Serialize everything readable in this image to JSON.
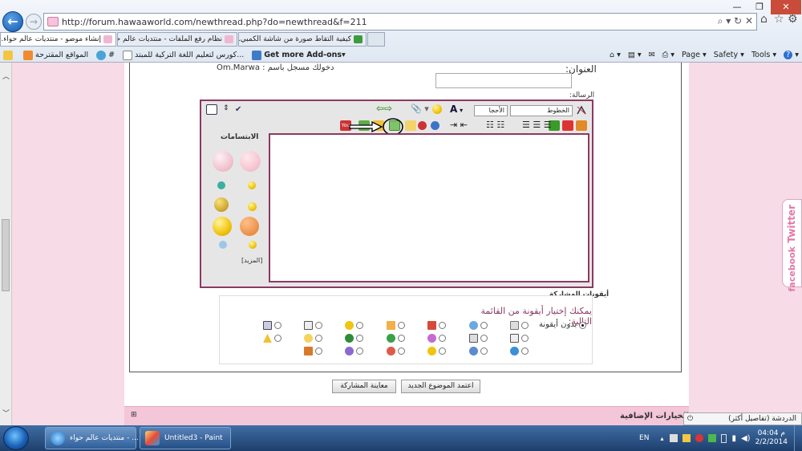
{
  "browser": {
    "url": "http://forum.hawaaworld.com/newthread.php?do=newthread&f=211",
    "tabs": [
      {
        "label": "إنشاء موضو - منتديات عالم حواء...",
        "active": true
      },
      {
        "label": "نظام رفع الملفات - منتديات عالم حواء",
        "active": false
      },
      {
        "label": "كيفية التقاط صورة من شاشة الكمبي...",
        "active": false
      }
    ],
    "favorites": [
      {
        "label": "المواقع المقترحة"
      },
      {
        "label": "كورس لتعليم اللغة التركية للمبتد..."
      },
      {
        "label": "Get more Add-ons"
      }
    ],
    "hash_label": "#",
    "commands": {
      "page": "Page",
      "safety": "Safety",
      "tools": "Tools",
      "help": "?"
    }
  },
  "form": {
    "logged_in": "دخولك مسجل باسم : Om.Marwa",
    "title_label": "العنوان:",
    "message_label": "الرسالة:",
    "font_select": "الخطوط",
    "size_select": "الأحجا",
    "smilies_title": "الابتسامات",
    "more_smilies": "[المزيد]",
    "post_icons_title": "أيقونات المشاركة",
    "post_icons_hint": "يمكنك إختيار أيقونة من القائمة التالية:",
    "no_icon": "بدون أيقونة",
    "submit_button": "اعتمد الموضوع الجديد",
    "preview_button": "معاينة المشاركة",
    "options_title": "الخيارات الإضافية"
  },
  "social": {
    "twitter": "Twitter",
    "facebook": "facebook"
  },
  "chat": {
    "label": "الدردشة (تفاصيل أكثر)"
  },
  "taskbar": {
    "items": [
      {
        "label": "منتديات عالم حواء - ..."
      },
      {
        "label": "Untitled3 - Paint"
      }
    ],
    "lang": "EN",
    "time": "04:04 م",
    "date": "2/2/2014"
  },
  "colors": {
    "accent": "#8a3a63",
    "page_bg": "#f7dbe6",
    "taskbar": "#1d3f6d"
  }
}
